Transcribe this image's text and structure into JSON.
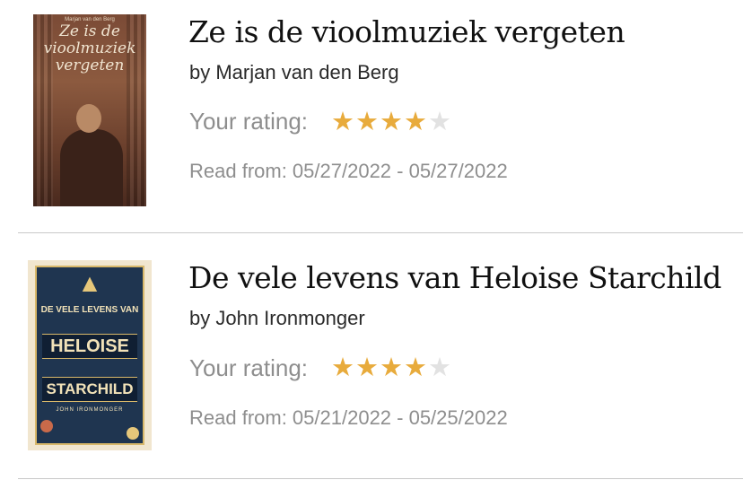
{
  "books": [
    {
      "title": "Ze is de vioolmuziek vergeten",
      "author": "by Marjan van den Berg",
      "rating_label": "Your rating:",
      "rating": 4,
      "rating_max": 5,
      "read_from": "Read from: 05/27/2022 - 05/27/2022",
      "cover": {
        "author_text": "Marjan van den Berg",
        "title_text": "Ze is de vioolmuziek vergeten"
      }
    },
    {
      "title": "De vele levens van Heloise Starchild",
      "author": "by John Ironmonger",
      "rating_label": "Your rating:",
      "rating": 4,
      "rating_max": 5,
      "read_from": "Read from: 05/21/2022 - 05/25/2022",
      "cover": {
        "small_title": "DE VELE LEVENS VAN",
        "title_line1": "HELOISE",
        "title_line2": "STARCHILD",
        "author_text": "JOHN IRONMONGER"
      }
    }
  ],
  "colors": {
    "star_filled": "#e8ab3c",
    "star_empty": "#e2e2e2",
    "secondary_text": "#8e8e8e",
    "divider": "#c8c8c8"
  }
}
